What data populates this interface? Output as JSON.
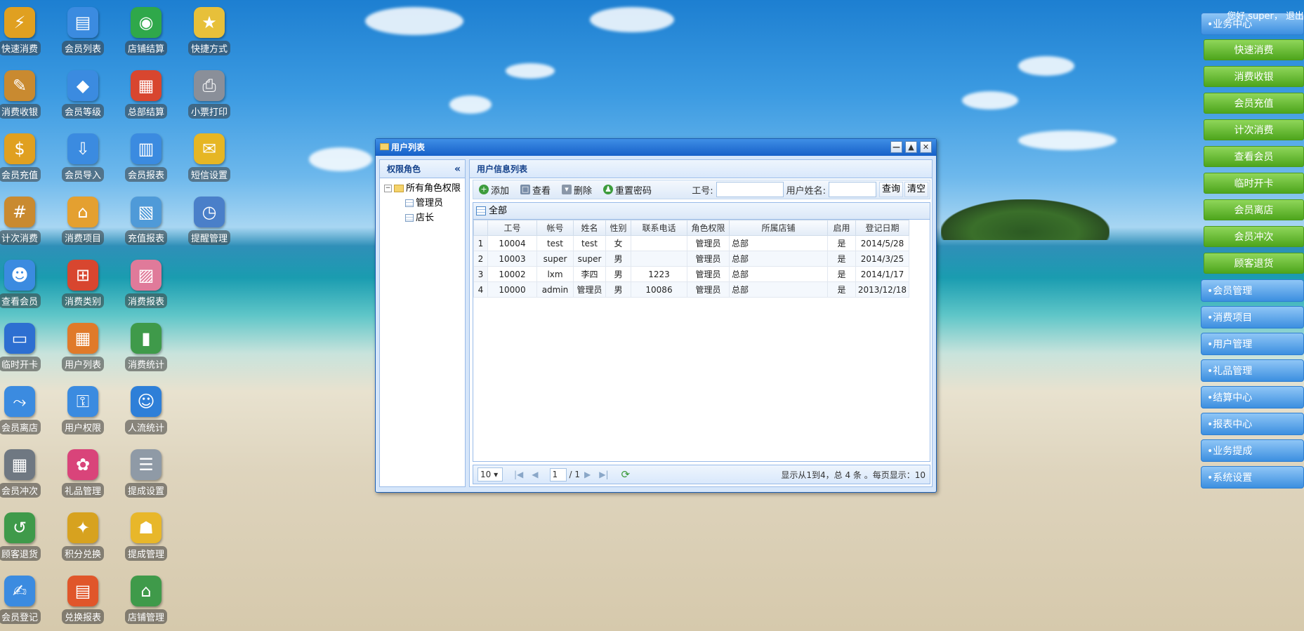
{
  "desktop_icons": [
    {
      "label": "快速消费",
      "icon": "fast-consume-icon",
      "color": "#e0a020"
    },
    {
      "label": "会员列表",
      "icon": "member-list-icon",
      "color": "#3b8be0"
    },
    {
      "label": "店铺结算",
      "icon": "shop-settlement-icon",
      "color": "#2fa84a"
    },
    {
      "label": "快捷方式",
      "icon": "shortcut-folder-icon",
      "color": "#e7c03a"
    },
    {
      "label": "消费收银",
      "icon": "cashier-icon",
      "color": "#c98a30"
    },
    {
      "label": "会员等级",
      "icon": "member-level-icon",
      "color": "#3b8be0"
    },
    {
      "label": "总部结算",
      "icon": "hq-settlement-icon",
      "color": "#d8462f"
    },
    {
      "label": "小票打印",
      "icon": "printer-icon",
      "color": "#8a8f99"
    },
    {
      "label": "会员充值",
      "icon": "member-recharge-icon",
      "color": "#e0a020"
    },
    {
      "label": "会员导入",
      "icon": "member-import-icon",
      "color": "#3b8be0"
    },
    {
      "label": "会员报表",
      "icon": "member-report-icon",
      "color": "#3b8be0"
    },
    {
      "label": "短信设置",
      "icon": "sms-settings-icon",
      "color": "#e6b624"
    },
    {
      "label": "计次消费",
      "icon": "count-consume-icon",
      "color": "#c98a30"
    },
    {
      "label": "消费项目",
      "icon": "consume-item-icon",
      "color": "#e4a030"
    },
    {
      "label": "充值报表",
      "icon": "recharge-report-icon",
      "color": "#4f9ad8"
    },
    {
      "label": "提醒管理",
      "icon": "reminder-clock-icon",
      "color": "#4a7fc9"
    },
    {
      "label": "查看会员",
      "icon": "view-member-icon",
      "color": "#3b8be0"
    },
    {
      "label": "消费类别",
      "icon": "consume-category-icon",
      "color": "#d8462f"
    },
    {
      "label": "消费报表",
      "icon": "consume-report-icon",
      "color": "#e07a9a"
    },
    {
      "label": "临时开卡",
      "icon": "temp-card-icon",
      "color": "#2d6fd1"
    },
    {
      "label": "用户列表",
      "icon": "user-list-icon",
      "color": "#e07a2a"
    },
    {
      "label": "消费统计",
      "icon": "consume-stats-icon",
      "color": "#3f9a4a"
    },
    {
      "label": "会员离店",
      "icon": "member-leave-icon",
      "color": "#3b8be0"
    },
    {
      "label": "用户权限",
      "icon": "user-permission-icon",
      "color": "#3b8be0"
    },
    {
      "label": "人流统计",
      "icon": "traffic-stats-icon",
      "color": "#2e7fd8"
    },
    {
      "label": "会员冲次",
      "icon": "calculator-icon",
      "color": "#6f7882"
    },
    {
      "label": "礼品管理",
      "icon": "gift-icon",
      "color": "#d9447a"
    },
    {
      "label": "提成设置",
      "icon": "commission-settings-icon",
      "color": "#8f9aa6"
    },
    {
      "label": "顾客退货",
      "icon": "customer-return-icon",
      "color": "#3f9a4a"
    },
    {
      "label": "积分兑换",
      "icon": "points-exchange-icon",
      "color": "#d7a21f"
    },
    {
      "label": "提成管理",
      "icon": "commission-manage-icon",
      "color": "#e8b72a"
    },
    {
      "label": "会员登记",
      "icon": "member-register-icon",
      "color": "#3b8be0"
    },
    {
      "label": "兑换报表",
      "icon": "exchange-report-icon",
      "color": "#e0562a"
    },
    {
      "label": "店铺管理",
      "icon": "shop-manage-icon",
      "color": "#3f9a4a"
    }
  ],
  "right_panel": {
    "top_user_text": "您好,super， 退出",
    "business_header": "•业务中心",
    "business_items": [
      "快速消费",
      "消费收银",
      "会员充值",
      "计次消费",
      "查看会员",
      "临时开卡",
      "会员离店",
      "会员冲次",
      "顾客退货"
    ],
    "sections": [
      "•会员管理",
      "•消费项目",
      "•用户管理",
      "•礼品管理",
      "•结算中心",
      "•报表中心",
      "•业务提成",
      "•系统设置"
    ]
  },
  "window": {
    "title": "用户列表",
    "buttons": {
      "minimize": "—",
      "maximize": "▲",
      "close": "✕"
    },
    "left_pane": {
      "header": "权限角色",
      "collapse_glyph": "«",
      "tree_root": "所有角色权限",
      "tree_children": [
        "管理员",
        "店长"
      ]
    },
    "right_pane": {
      "header": "用户信息列表",
      "toolbar": {
        "add": "添加",
        "view": "查看",
        "delete": "删除",
        "reset_password": "重置密码",
        "id_label": "工号:",
        "name_label": "用户姓名:",
        "query": "查询",
        "clear": "清空"
      },
      "grid_title": "全部",
      "columns": [
        "",
        "工号",
        "帐号",
        "姓名",
        "性别",
        "联系电话",
        "角色权限",
        "所属店铺",
        "启用",
        "登记日期"
      ],
      "rows": [
        [
          "1",
          "10004",
          "test",
          "test",
          "女",
          "",
          "管理员",
          "总部",
          "是",
          "2014/5/28"
        ],
        [
          "2",
          "10003",
          "super",
          "super",
          "男",
          "",
          "管理员",
          "总部",
          "是",
          "2014/3/25"
        ],
        [
          "3",
          "10002",
          "lxm",
          "李四",
          "男",
          "1223",
          "管理员",
          "总部",
          "是",
          "2014/1/17"
        ],
        [
          "4",
          "10000",
          "admin",
          "管理员",
          "男",
          "10086",
          "管理员",
          "总部",
          "是",
          "2013/12/18"
        ]
      ],
      "pager": {
        "page_size": "10",
        "page": "1",
        "total_pages": "/ 1",
        "info": "显示从1到4，总 4 条 。每页显示：10"
      }
    }
  }
}
